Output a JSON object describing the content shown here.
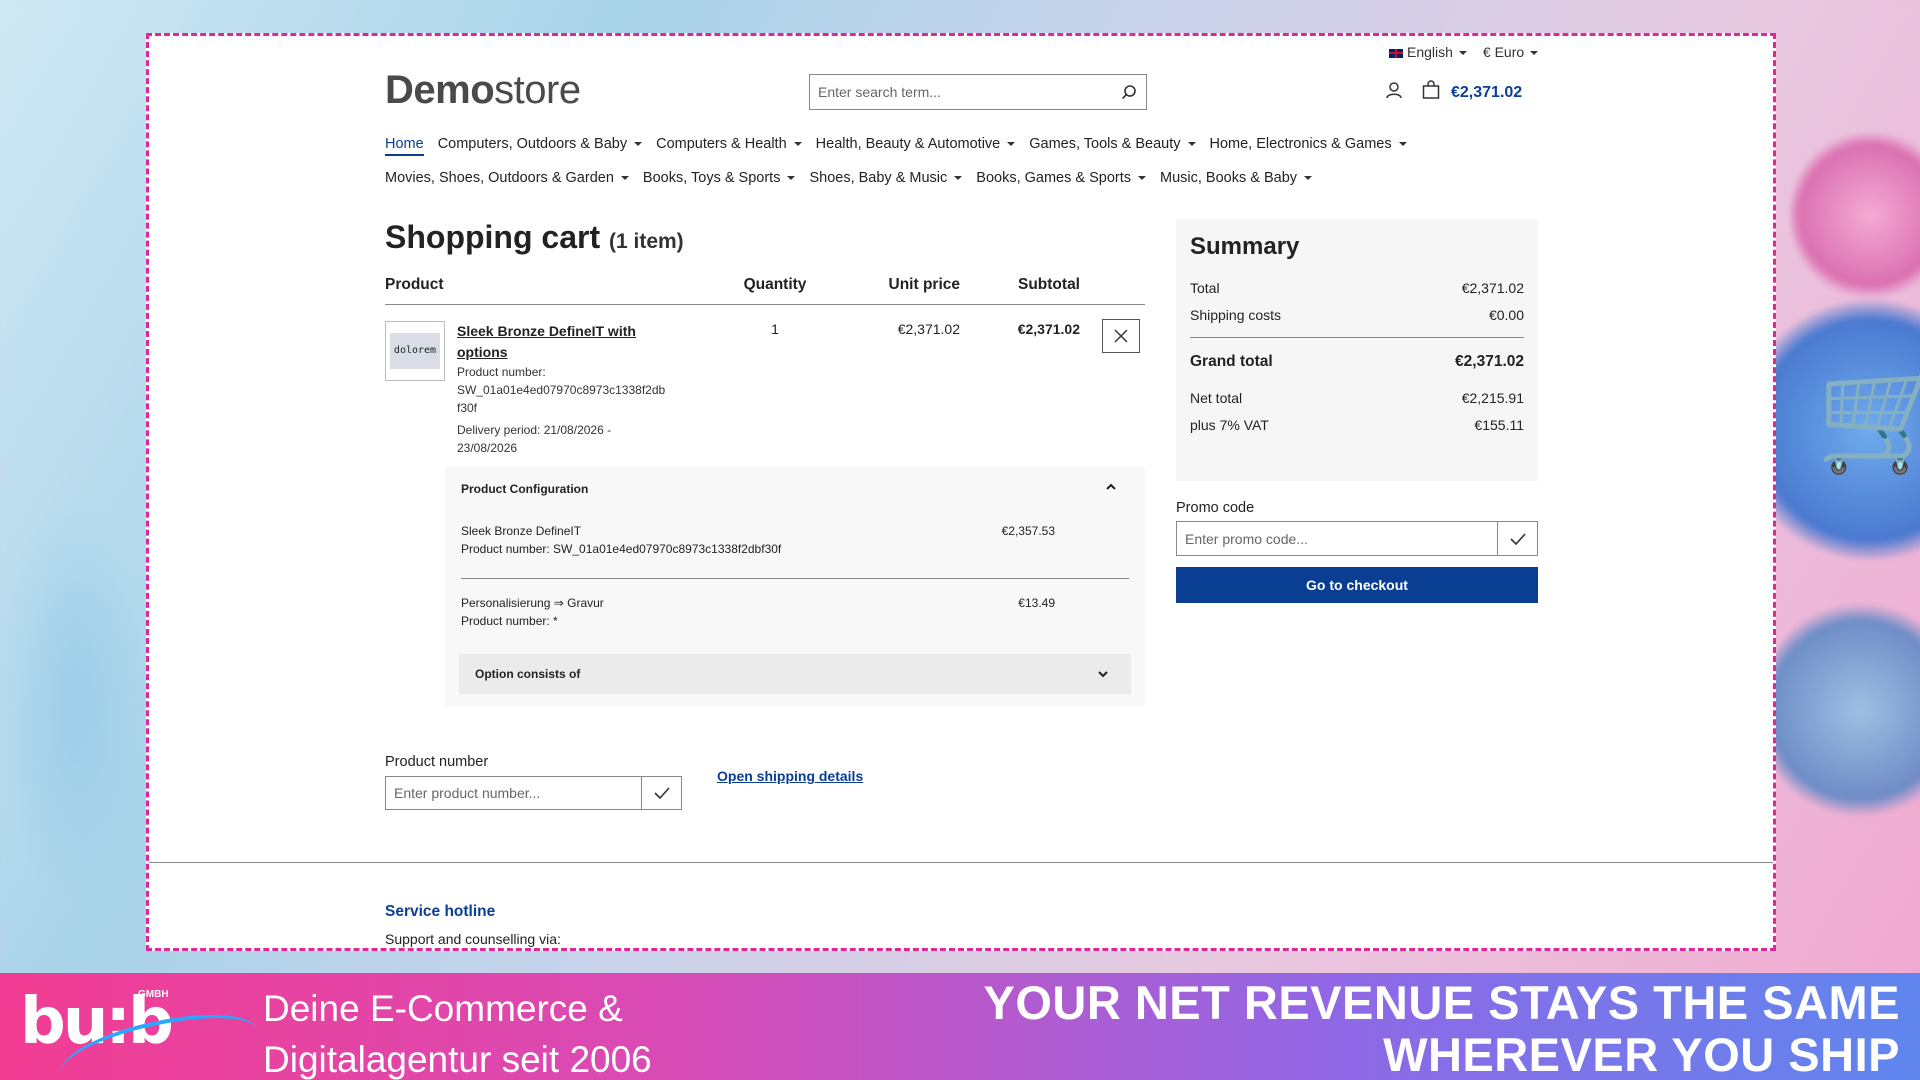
{
  "topbar": {
    "language": "English",
    "currency": "€ Euro"
  },
  "logo": {
    "bold": "Demo",
    "light": "store"
  },
  "search": {
    "placeholder": "Enter search term..."
  },
  "header": {
    "cart_total": "€2,371.02"
  },
  "nav": {
    "row1": [
      {
        "label": "Home"
      },
      {
        "label": "Computers, Outdoors & Baby"
      },
      {
        "label": "Computers & Health"
      },
      {
        "label": "Health, Beauty & Automotive"
      },
      {
        "label": "Games, Tools & Beauty"
      },
      {
        "label": "Home, Electronics & Games"
      }
    ],
    "row2": [
      {
        "label": "Movies, Shoes, Outdoors & Garden"
      },
      {
        "label": "Books, Toys & Sports"
      },
      {
        "label": "Shoes, Baby & Music"
      },
      {
        "label": "Books, Games & Sports"
      },
      {
        "label": "Music, Books & Baby"
      }
    ]
  },
  "cart": {
    "title": "Shopping cart",
    "count": "(1 item)",
    "headers": {
      "product": "Product",
      "quantity": "Quantity",
      "unit_price": "Unit price",
      "subtotal": "Subtotal"
    },
    "item": {
      "thumb_text": "dolorem",
      "name": "Sleek Bronze DefineIT with options",
      "number_label": "Product number:",
      "number": "SW_01a01e4ed07970c8973c1338f2dbf30f",
      "delivery": "Delivery period: 21/08/2026 - 23/08/2026",
      "quantity": "1",
      "unit_price": "€2,371.02",
      "subtotal": "€2,371.02"
    },
    "config": {
      "title": "Product Configuration",
      "line1_name": "Sleek Bronze DefineIT",
      "line1_number": "Product number: SW_01a01e4ed07970c8973c1338f2dbf30f",
      "line1_price": "€2,357.53",
      "line2_name": "Personalisierung ⇒ Gravur",
      "line2_number": "Product number: *",
      "line2_price": "€13.49",
      "option_label": "Option consists of"
    }
  },
  "product_number": {
    "label": "Product number",
    "placeholder": "Enter product number..."
  },
  "shipping_link": "Open shipping details",
  "summary": {
    "title": "Summary",
    "total_label": "Total",
    "total": "€2,371.02",
    "shipping_label": "Shipping costs",
    "shipping": "€0.00",
    "grand_label": "Grand total",
    "grand": "€2,371.02",
    "net_label": "Net total",
    "net": "€2,215.91",
    "vat_label": "plus 7% VAT",
    "vat": "€155.11"
  },
  "promo": {
    "label": "Promo code",
    "placeholder": "Enter promo code..."
  },
  "checkout_label": "Go to checkout",
  "footer": {
    "hotline": "Service hotline",
    "sub": "Support and counselling via:"
  },
  "banner": {
    "brand": "bu:b",
    "gmbh": "GMBH",
    "tagline_1": "Deine E-Commerce &",
    "tagline_2": "Digitalagentur seit 2006",
    "headline": "YOUR NET REVENUE STAYS THE SAME WHEREVER YOU SHIP"
  },
  "colors": {
    "accent": "#0a3e93",
    "frame_border": "#e0269b"
  }
}
